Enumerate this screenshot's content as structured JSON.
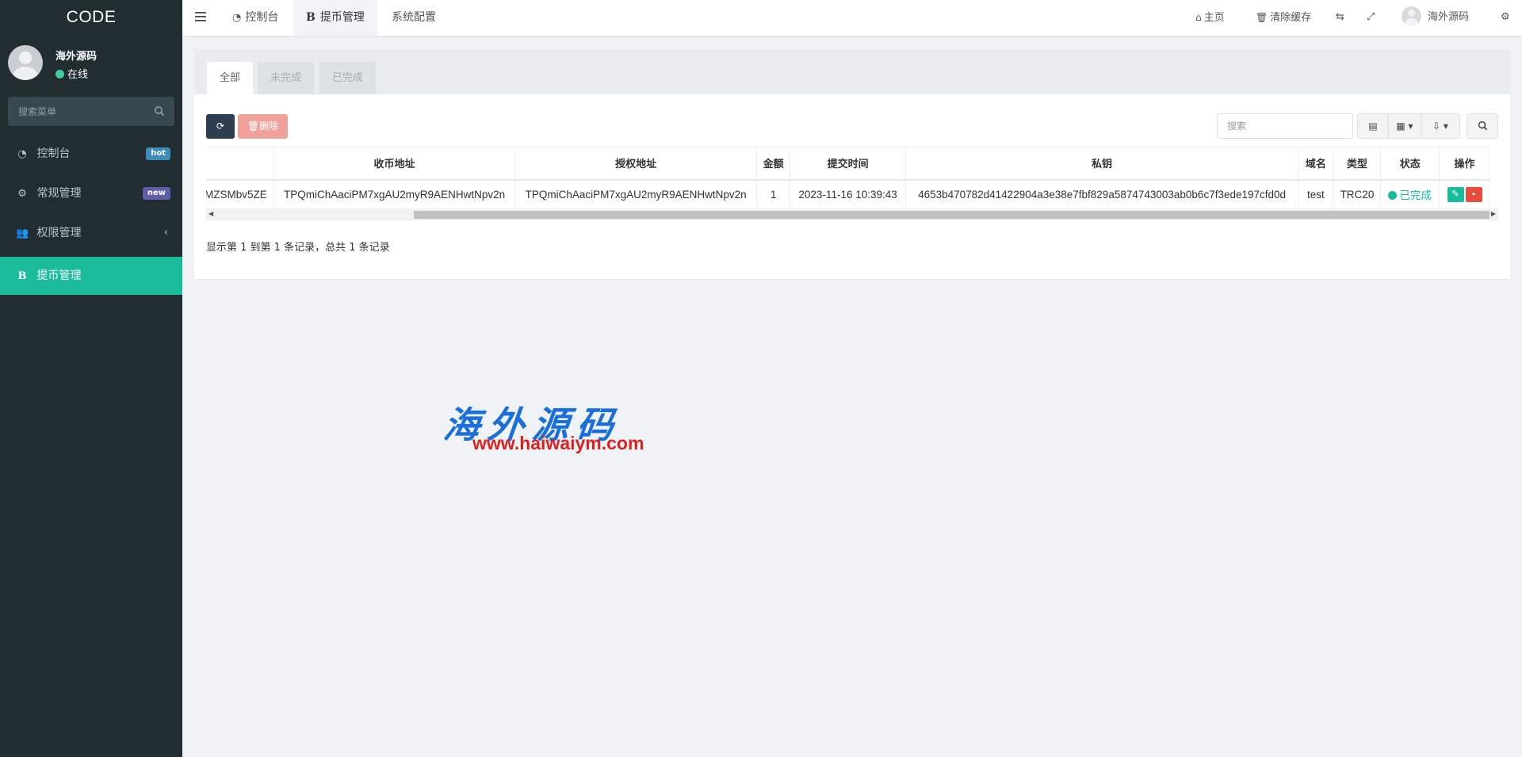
{
  "sidebar": {
    "logo": "CODE",
    "user_name": "海外源码",
    "user_status": "在线",
    "search_placeholder": "搜索菜单",
    "items": [
      {
        "label": "控制台",
        "icon": "dashboard-icon",
        "badge": "hot"
      },
      {
        "label": "常规管理",
        "icon": "cogs-icon",
        "badge": "new"
      },
      {
        "label": "权限管理",
        "icon": "users-icon",
        "badge": ""
      },
      {
        "label": "提币管理",
        "icon": "b-icon",
        "badge": "",
        "active": true
      }
    ]
  },
  "topnav": {
    "tabs": [
      {
        "label": "控制台",
        "icon": "dashboard-icon"
      },
      {
        "label": "提币管理",
        "icon": "b-icon",
        "active": true
      },
      {
        "label": "系统配置"
      }
    ],
    "home_label": "主页",
    "clear_cache_label": "清除缓存",
    "user_name": "海外源码"
  },
  "content": {
    "tabs": [
      {
        "label": "全部",
        "active": true
      },
      {
        "label": "未完成"
      },
      {
        "label": "已完成"
      }
    ],
    "delete_label": "删除",
    "search_placeholder": "搜索",
    "table": {
      "columns": [
        "",
        "收币地址",
        "授权地址",
        "金额",
        "提交时间",
        "私钥",
        "域名",
        "类型",
        "状态",
        "操作"
      ],
      "rows": [
        {
          "first": "MZSMbv5ZE",
          "receive_address": "TPQmiChAaciPM7xgAU2myR9AENHwtNpv2n",
          "auth_address": "TPQmiChAaciPM7xgAU2myR9AENHwtNpv2n",
          "amount": "1",
          "submit_time": "2023-11-16 10:39:43",
          "private_key": "4653b470782d41422904a3e38e7fbf829a5874743003ab0b6c7f3ede197cfd0d",
          "domain": "test",
          "type": "TRC20",
          "status": "已完成"
        }
      ]
    },
    "pagination_info": "显示第 1 到第 1 条记录，总共 1 条记录"
  },
  "watermark": {
    "cn": "海外源码",
    "url": "www.haiwaiym.com"
  },
  "colors": {
    "sidebar_bg": "#222d32",
    "accent": "#1abc9c",
    "danger": "#e74c3c"
  }
}
